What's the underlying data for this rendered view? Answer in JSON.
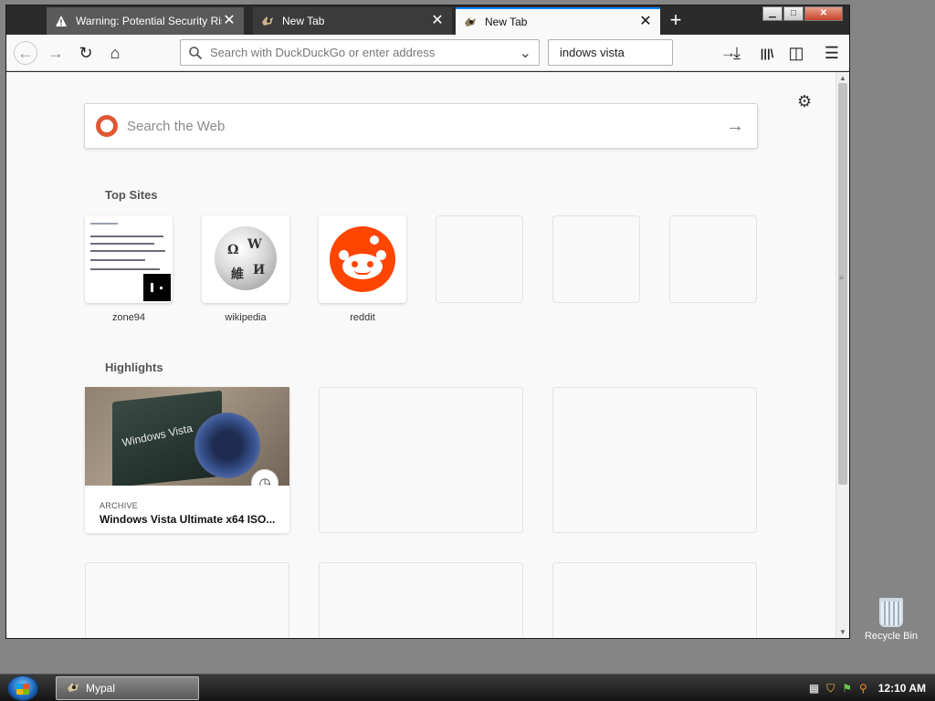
{
  "window": {
    "tabs": [
      {
        "label": "Warning: Potential Security Risk",
        "icon": "warning-icon",
        "close": "✕"
      },
      {
        "label": "New Tab",
        "icon": "mypal-icon",
        "close": "✕"
      },
      {
        "label": "New Tab",
        "icon": "mypal-icon",
        "close": "✕",
        "active": true
      }
    ],
    "new_tab": "+",
    "controls": {
      "minimize": "▁",
      "maximize": "□",
      "close": "✕"
    }
  },
  "toolbar": {
    "back": "←",
    "forward": "→",
    "reload": "↻",
    "home": "⌂",
    "url_placeholder": "Search with DuckDuckGo or enter address",
    "url_value": "",
    "dropdown": "⌄",
    "search_value": "indows vista",
    "search_go": "→",
    "download": "⤓",
    "library": "|||\\",
    "sidebar": "◫",
    "menu": "☰"
  },
  "newtab": {
    "gear": "⚙",
    "web_search_placeholder": "Search the Web",
    "web_search_go": "→",
    "top_sites_title": "Top Sites",
    "top_sites": [
      {
        "name": "zone94"
      },
      {
        "name": "wikipedia"
      },
      {
        "name": "reddit"
      },
      {
        "name": ""
      },
      {
        "name": ""
      },
      {
        "name": ""
      }
    ],
    "highlights_title": "Highlights",
    "highlights": [
      {
        "context": "ARCHIVE",
        "title": "Windows Vista Ultimate x64 ISO...",
        "thumb_text": "Windows Vista"
      }
    ]
  },
  "desktop": {
    "recycle_bin": "Recycle Bin"
  },
  "taskbar": {
    "task_label": "Mypal",
    "clock": "12:10 AM"
  },
  "colors": {
    "accent": "#0a84ff",
    "reddit": "#ff4500",
    "ddg": "#de5833"
  }
}
